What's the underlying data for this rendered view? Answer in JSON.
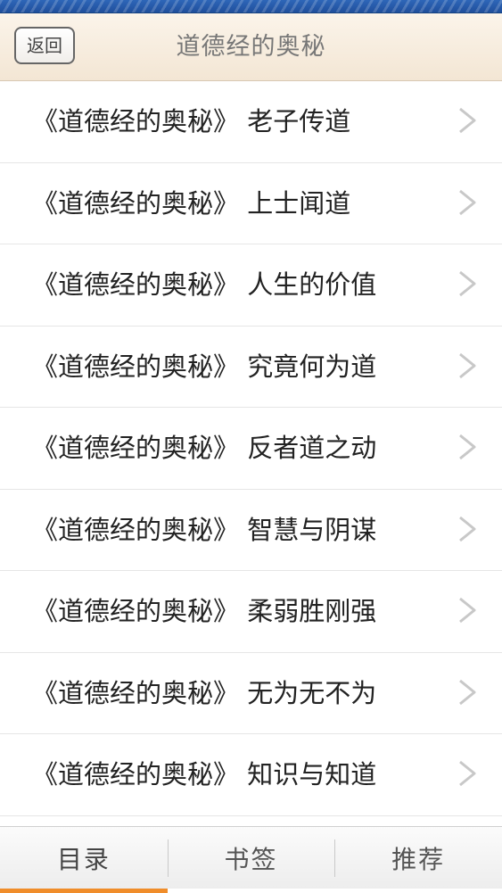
{
  "header": {
    "back_label": "返回",
    "title": "道德经的奥秘"
  },
  "list": {
    "items": [
      {
        "label": "《道德经的奥秘》 老子传道"
      },
      {
        "label": "《道德经的奥秘》 上士闻道"
      },
      {
        "label": "《道德经的奥秘》 人生的价值"
      },
      {
        "label": "《道德经的奥秘》 究竟何为道"
      },
      {
        "label": "《道德经的奥秘》 反者道之动"
      },
      {
        "label": "《道德经的奥秘》 智慧与阴谋"
      },
      {
        "label": "《道德经的奥秘》 柔弱胜刚强"
      },
      {
        "label": "《道德经的奥秘》 无为无不为"
      },
      {
        "label": "《道德经的奥秘》 知识与知道"
      }
    ],
    "chevron_icon": "chevron-right-icon"
  },
  "tabs": [
    {
      "label": "目录",
      "active": true
    },
    {
      "label": "书签",
      "active": false
    },
    {
      "label": "推荐",
      "active": false
    }
  ],
  "colors": {
    "header_bg": "#f3e6d4",
    "top_band": "#1f4f9c",
    "active_tab_accent": "#f08d2a",
    "chevron": "#c8c8c8"
  }
}
